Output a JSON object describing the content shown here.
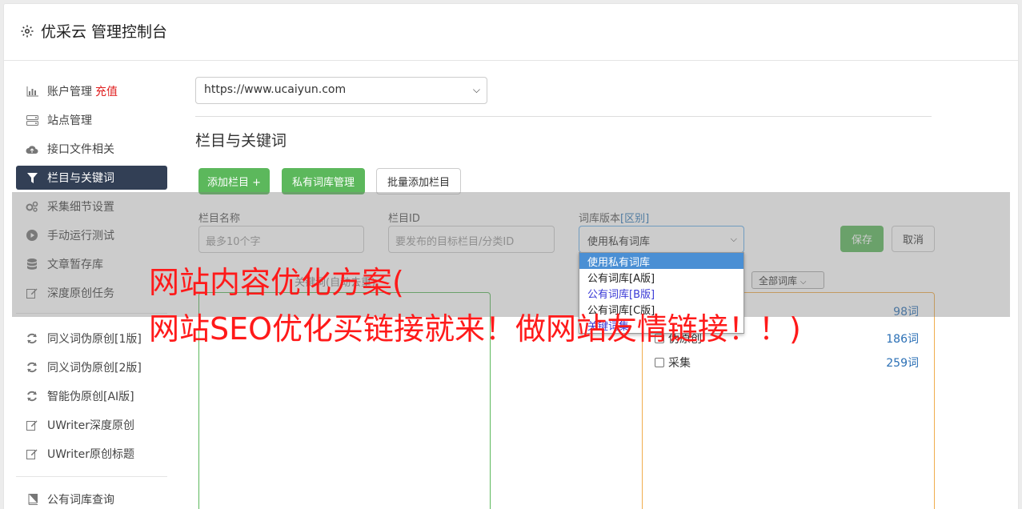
{
  "app": {
    "title": "优采云 管理控制台",
    "icon": "gear-icon"
  },
  "sidebar": {
    "items": [
      {
        "label": "账户管理",
        "icon": "bar-chart-icon",
        "extra": "充值"
      },
      {
        "label": "站点管理",
        "icon": "server-icon"
      },
      {
        "label": "接口文件相关",
        "icon": "cloud-upload-icon"
      },
      {
        "label": "栏目与关键词",
        "icon": "filter-icon",
        "active": true
      },
      {
        "label": "采集细节设置",
        "icon": "gears-icon"
      },
      {
        "label": "手动运行测试",
        "icon": "play-circle-icon"
      },
      {
        "label": "文章暂存库",
        "icon": "database-icon"
      },
      {
        "label": "深度原创任务",
        "icon": "edit-icon"
      },
      {
        "label": "同义词伪原创[1版]",
        "icon": "refresh-icon"
      },
      {
        "label": "同义词伪原创[2版]",
        "icon": "refresh-icon"
      },
      {
        "label": "智能伪原创[AI版]",
        "icon": "refresh-icon"
      },
      {
        "label": "UWriter深度原创",
        "icon": "edit-icon"
      },
      {
        "label": "UWriter原创标题",
        "icon": "edit-icon"
      },
      {
        "label": "公有词库查询",
        "icon": "book-icon"
      }
    ]
  },
  "main": {
    "site_select": "https://www.ucaiyun.com",
    "section_title": "栏目与关键词",
    "buttons": {
      "add_column": "添加栏目 +",
      "private_lib": "私有词库管理",
      "batch_add": "批量添加栏目"
    },
    "form": {
      "name_label": "栏目名称",
      "name_placeholder": "最多10个字",
      "id_label": "栏目ID",
      "id_placeholder": "要发布的目标栏目/分类ID",
      "version_label": "词库版本",
      "version_label_link": "[区别]",
      "version_value": "使用私有词库",
      "save": "保存",
      "cancel": "取消"
    },
    "version_options": [
      "使用私有词库",
      "公有词库[A版]",
      "公有词库[B版]",
      "公有词库[C版]",
      "关键词集"
    ],
    "keyword_hint": "关键词(自动去重)",
    "lib_filter": "全部词库",
    "libraries": [
      {
        "name": "",
        "count": "98词"
      },
      {
        "name": "伪原创",
        "count": "186词"
      },
      {
        "name": "采集",
        "count": "259词"
      }
    ]
  },
  "promo": {
    "line1": "网站内容优化方案(",
    "line2": "网站SEO优化买链接就来！做网站友情链接！！)"
  }
}
